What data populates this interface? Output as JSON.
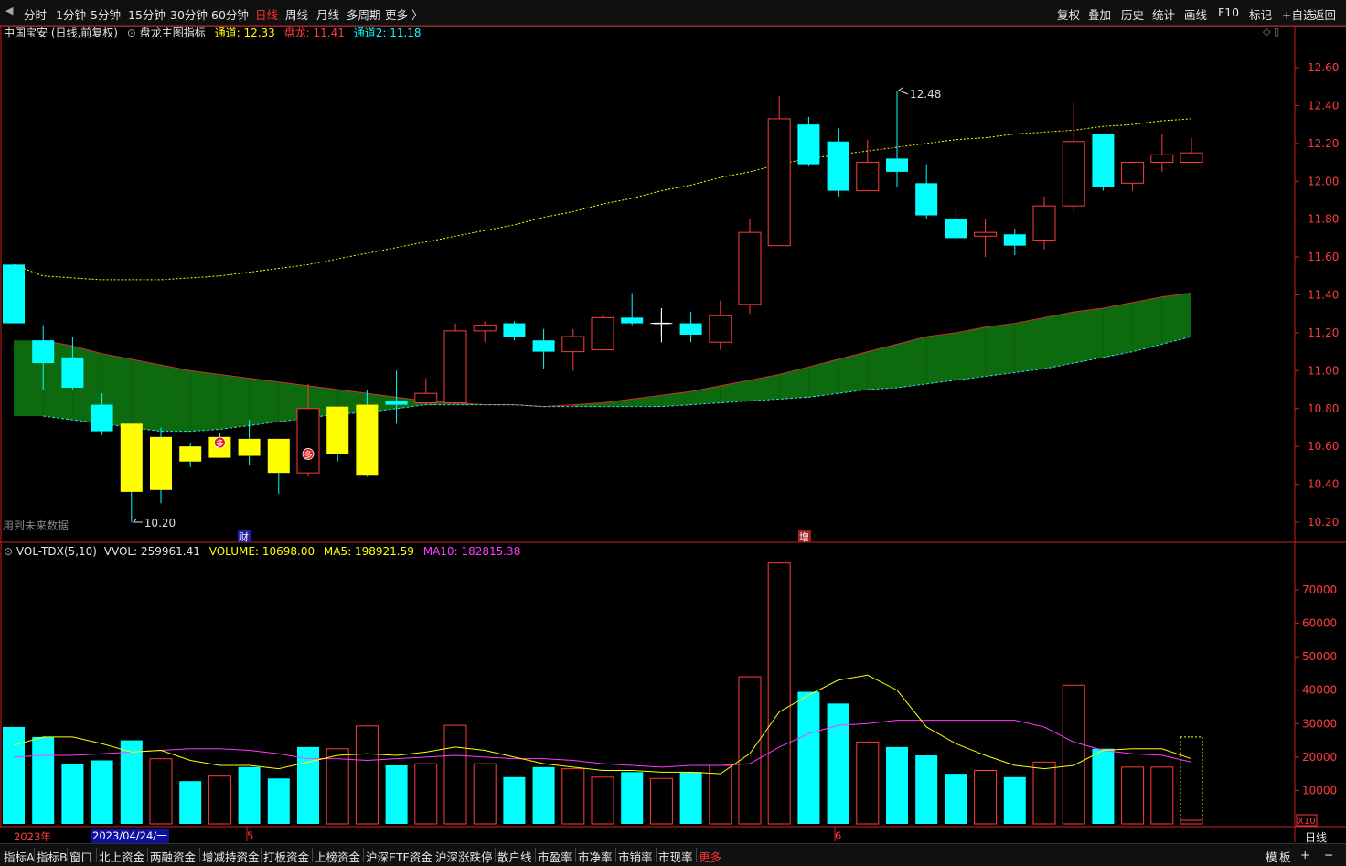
{
  "toolbar": {
    "periods": [
      "分时",
      "1分钟",
      "5分钟",
      "15分钟",
      "30分钟",
      "60分钟",
      "日线",
      "周线",
      "月线",
      "多周期",
      "更多 〉"
    ],
    "active_period": "日线",
    "right": [
      "复权",
      "叠加",
      "历史",
      "统计",
      "画线",
      "F10",
      "标记",
      "+自选",
      "返回"
    ]
  },
  "main_header": {
    "stock": "中国宝安 (日线,前复权)",
    "indicator": "盘龙主图指标",
    "ch1_label": "通道:",
    "ch1_value": "12.33",
    "pl_label": "盘龙:",
    "pl_value": "11.41",
    "ch2_label": "通道2:",
    "ch2_value": "11.18"
  },
  "vol_header": {
    "name": "VOL-TDX(5,10)",
    "vvol_label": "VVOL:",
    "vvol_value": "259961.41",
    "volume_label": "VOLUME:",
    "volume_value": "10698.00",
    "ma5_label": "MA5:",
    "ma5_value": "198921.59",
    "ma10_label": "MA10:",
    "ma10_value": "182815.38"
  },
  "notes": {
    "future_data": "用到未来数据",
    "high_label": "12.48",
    "low_label": "10.20",
    "signal": "多",
    "cai": "财",
    "zeng": "增",
    "x10": "X10"
  },
  "date_axis": {
    "year": "2023年",
    "cursor_date": "2023/04/24/一",
    "m5": "5",
    "m6": "6",
    "right_label": "日线",
    "plus": "+",
    "minus": "−"
  },
  "bottom_tabs": [
    "指标A",
    "指标B",
    "窗口",
    "北上资金",
    "两融资金",
    "增减持资金",
    "打板资金",
    "上榜资金",
    "沪深ETF资金",
    "沪深涨跌停",
    "散户线",
    "市盈率",
    "市净率",
    "市销率",
    "市现率",
    "更多"
  ],
  "bottom_right": [
    "模",
    "板",
    "+",
    "−"
  ],
  "colors": {
    "up": "#ff3c3c",
    "down": "#00ffff",
    "yellow": "#ffff00",
    "magenta": "#ff3cff",
    "band_green": "#0e6a0e",
    "band_red": "#3a0404",
    "axis_red": "#cc2222"
  },
  "chart_data": [
    {
      "type": "candlestick",
      "yaxis": {
        "ticks": [
          10.2,
          10.4,
          10.6,
          10.8,
          11.0,
          11.2,
          11.4,
          11.6,
          11.8,
          12.0,
          12.2,
          12.4,
          12.6
        ],
        "range": [
          10.12,
          12.66
        ]
      },
      "ohlc": [
        {
          "o": 11.56,
          "h": 11.56,
          "l": 11.25,
          "c": 11.25,
          "bar": "down"
        },
        {
          "o": 11.16,
          "h": 11.24,
          "l": 10.9,
          "c": 11.04,
          "bar": "down"
        },
        {
          "o": 11.07,
          "h": 11.18,
          "l": 10.9,
          "c": 10.91,
          "bar": "down"
        },
        {
          "o": 10.82,
          "h": 10.88,
          "l": 10.66,
          "c": 10.68,
          "bar": "down"
        },
        {
          "o": 10.72,
          "h": 10.72,
          "l": 10.2,
          "c": 10.36,
          "bar": "down"
        },
        {
          "o": 10.65,
          "h": 10.7,
          "l": 10.3,
          "c": 10.37,
          "bar": "down"
        },
        {
          "o": 10.6,
          "h": 10.62,
          "l": 10.49,
          "c": 10.52,
          "bar": "down"
        },
        {
          "o": 10.65,
          "h": 10.67,
          "l": 10.55,
          "c": 10.54,
          "bar": "down"
        },
        {
          "o": 10.64,
          "h": 10.74,
          "l": 10.5,
          "c": 10.55,
          "bar": "down"
        },
        {
          "o": 10.64,
          "h": 10.64,
          "l": 10.35,
          "c": 10.46,
          "bar": "down"
        },
        {
          "o": 10.46,
          "h": 10.93,
          "l": 10.44,
          "c": 10.8,
          "bar": "up"
        },
        {
          "o": 10.81,
          "h": 10.81,
          "l": 10.52,
          "c": 10.56,
          "bar": "down"
        },
        {
          "o": 10.82,
          "h": 10.9,
          "l": 10.44,
          "c": 10.45,
          "bar": "down"
        },
        {
          "o": 10.82,
          "h": 11.0,
          "l": 10.72,
          "c": 10.84,
          "bar": "down"
        },
        {
          "o": 10.83,
          "h": 10.96,
          "l": 10.82,
          "c": 10.88,
          "bar": "up"
        },
        {
          "o": 10.83,
          "h": 11.25,
          "l": 10.82,
          "c": 11.21,
          "bar": "up"
        },
        {
          "o": 11.21,
          "h": 11.26,
          "l": 11.15,
          "c": 11.24,
          "bar": "up"
        },
        {
          "o": 11.25,
          "h": 11.26,
          "l": 11.16,
          "c": 11.18,
          "bar": "down"
        },
        {
          "o": 11.16,
          "h": 11.22,
          "l": 11.01,
          "c": 11.1,
          "bar": "down"
        },
        {
          "o": 11.1,
          "h": 11.22,
          "l": 11.0,
          "c": 11.18,
          "bar": "up"
        },
        {
          "o": 11.11,
          "h": 11.29,
          "l": 11.11,
          "c": 11.28,
          "bar": "up"
        },
        {
          "o": 11.28,
          "h": 11.41,
          "l": 11.24,
          "c": 11.25,
          "bar": "down"
        },
        {
          "o": 11.25,
          "h": 11.33,
          "l": 11.15,
          "c": 11.25,
          "bar": "doji"
        },
        {
          "o": 11.25,
          "h": 11.31,
          "l": 11.15,
          "c": 11.19,
          "bar": "down"
        },
        {
          "o": 11.15,
          "h": 11.37,
          "l": 11.11,
          "c": 11.29,
          "bar": "up"
        },
        {
          "o": 11.35,
          "h": 11.8,
          "l": 11.3,
          "c": 11.73,
          "bar": "up"
        },
        {
          "o": 11.66,
          "h": 12.45,
          "l": 11.66,
          "c": 12.33,
          "bar": "up"
        },
        {
          "o": 12.3,
          "h": 12.34,
          "l": 12.08,
          "c": 12.09,
          "bar": "down"
        },
        {
          "o": 12.21,
          "h": 12.28,
          "l": 11.92,
          "c": 11.95,
          "bar": "down"
        },
        {
          "o": 11.95,
          "h": 12.22,
          "l": 11.95,
          "c": 12.1,
          "bar": "up"
        },
        {
          "o": 12.12,
          "h": 12.48,
          "l": 11.97,
          "c": 12.05,
          "bar": "down"
        },
        {
          "o": 11.99,
          "h": 12.09,
          "l": 11.8,
          "c": 11.82,
          "bar": "down"
        },
        {
          "o": 11.8,
          "h": 11.87,
          "l": 11.68,
          "c": 11.7,
          "bar": "down"
        },
        {
          "o": 11.71,
          "h": 11.8,
          "l": 11.6,
          "c": 11.73,
          "bar": "up"
        },
        {
          "o": 11.72,
          "h": 11.75,
          "l": 11.61,
          "c": 11.66,
          "bar": "down"
        },
        {
          "o": 11.69,
          "h": 11.92,
          "l": 11.64,
          "c": 11.87,
          "bar": "up"
        },
        {
          "o": 11.87,
          "h": 12.42,
          "l": 11.84,
          "c": 12.21,
          "bar": "up"
        },
        {
          "o": 12.25,
          "h": 12.25,
          "l": 11.95,
          "c": 11.97,
          "bar": "down"
        },
        {
          "o": 11.99,
          "h": 12.1,
          "l": 11.95,
          "c": 12.1,
          "bar": "up"
        },
        {
          "o": 12.1,
          "h": 12.25,
          "l": 12.05,
          "c": 12.14,
          "bar": "up"
        },
        {
          "o": 12.1,
          "h": 12.23,
          "l": 12.1,
          "c": 12.15,
          "bar": "up"
        }
      ],
      "channel_upper": [
        11.56,
        11.5,
        11.49,
        11.48,
        11.48,
        11.48,
        11.49,
        11.5,
        11.52,
        11.54,
        11.56,
        11.59,
        11.62,
        11.65,
        11.68,
        11.71,
        11.74,
        11.77,
        11.81,
        11.84,
        11.88,
        11.91,
        11.95,
        11.98,
        12.02,
        12.05,
        12.09,
        12.12,
        12.14,
        12.16,
        12.18,
        12.2,
        12.22,
        12.23,
        12.25,
        12.26,
        12.27,
        12.29,
        12.3,
        12.32,
        12.33
      ],
      "panlong": [
        null,
        11.16,
        11.13,
        11.09,
        11.06,
        11.03,
        11.0,
        10.98,
        10.96,
        10.94,
        10.92,
        10.9,
        10.88,
        10.86,
        10.84,
        10.83,
        10.82,
        10.82,
        10.81,
        10.82,
        10.83,
        10.85,
        10.87,
        10.89,
        10.92,
        10.95,
        10.98,
        11.02,
        11.06,
        11.1,
        11.14,
        11.18,
        11.2,
        11.23,
        11.25,
        11.28,
        11.31,
        11.33,
        11.36,
        11.39,
        11.41
      ],
      "channel2": [
        null,
        10.76,
        10.74,
        10.72,
        10.7,
        10.68,
        10.68,
        10.69,
        10.71,
        10.73,
        10.75,
        10.77,
        10.78,
        10.8,
        10.82,
        10.82,
        10.82,
        10.82,
        10.81,
        10.81,
        10.81,
        10.81,
        10.81,
        10.82,
        10.83,
        10.84,
        10.85,
        10.86,
        10.88,
        10.9,
        10.91,
        10.93,
        10.95,
        10.97,
        10.99,
        11.01,
        11.04,
        11.07,
        11.1,
        11.14,
        11.18
      ]
    },
    {
      "type": "bar",
      "yaxis": {
        "ticks": [
          10000,
          20000,
          30000,
          40000,
          50000,
          60000,
          70000
        ]
      },
      "volume": [
        29000,
        26000,
        18000,
        19000,
        25000,
        19500,
        12800,
        14300,
        17000,
        13600,
        23000,
        22500,
        29300,
        17500,
        18000,
        29500,
        18000,
        14000,
        17000,
        16500,
        14000,
        15500,
        13600,
        15500,
        17500,
        44000,
        78000,
        39500,
        36000,
        24500,
        23000,
        20500,
        15000,
        16000,
        14000,
        18500,
        41500,
        22500,
        17000,
        17000,
        26000
      ],
      "vol_color": [
        "down",
        "down",
        "down",
        "down",
        "down",
        "up",
        "down",
        "up",
        "down",
        "down",
        "down",
        "up",
        "up",
        "down",
        "up",
        "up",
        "up",
        "down",
        "down",
        "up",
        "up",
        "down",
        "up",
        "down",
        "up",
        "up",
        "up",
        "down",
        "down",
        "up",
        "down",
        "down",
        "down",
        "up",
        "down",
        "up",
        "up",
        "down",
        "up",
        "up",
        "yellow"
      ],
      "ma5": [
        23500,
        26000,
        26000,
        24000,
        21500,
        22000,
        19000,
        17500,
        17500,
        16500,
        18500,
        20500,
        21000,
        20500,
        21500,
        23000,
        22000,
        20000,
        18000,
        17000,
        16000,
        16000,
        15500,
        15500,
        15000,
        21000,
        33500,
        38500,
        43000,
        44500,
        40000,
        29000,
        24000,
        20500,
        17500,
        16500,
        17500,
        22000,
        22500,
        22500,
        19500
      ],
      "ma10": [
        20000,
        20500,
        20500,
        21000,
        21500,
        22000,
        22500,
        22500,
        22000,
        21000,
        19500,
        19500,
        19000,
        19500,
        20000,
        20500,
        20000,
        19500,
        19500,
        19000,
        18000,
        17500,
        17000,
        17500,
        17500,
        18000,
        23000,
        27000,
        29500,
        30000,
        31000,
        31000,
        31000,
        31000,
        31000,
        29000,
        24500,
        22000,
        21000,
        20500,
        18500
      ]
    }
  ]
}
